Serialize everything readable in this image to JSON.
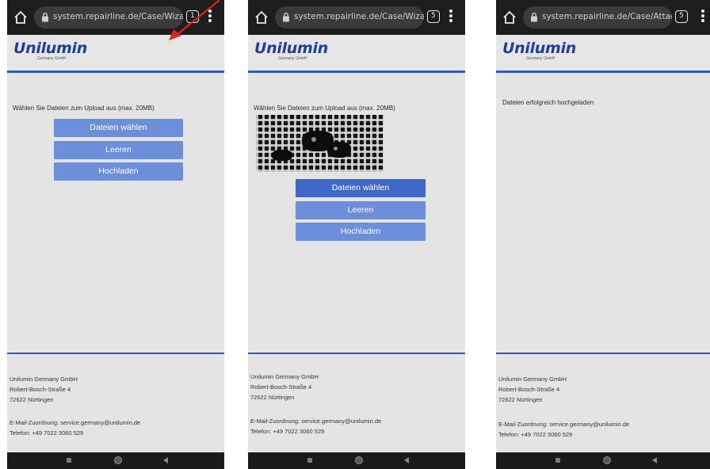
{
  "phones": [
    {
      "url": "system.repairline.de/Case/Wizard/A",
      "tab_count": "1",
      "logo": "Unilumin",
      "logo_sub": "Germany GmbH",
      "message": "Wählen Sie Dateien zum Upload aus (max. 20MB)",
      "buttons": [
        "Dateien wählen",
        "Leeren",
        "Hochladen"
      ]
    },
    {
      "url": "system.repairline.de/Case/Wizard/A",
      "tab_count": "5",
      "logo": "Unilumin",
      "logo_sub": "Germany GmbH",
      "message": "Wählen Sie Dateien zum Upload aus (max. 20MB)",
      "buttons": [
        "Dateien wählen",
        "Leeren",
        "Hochladen"
      ]
    },
    {
      "url": "system.repairline.de/Case/Attachme",
      "tab_count": "5",
      "logo": "Unilumin",
      "logo_sub": "Germany GmbH",
      "message": "Dateien erfolgreich hochgeladen"
    }
  ],
  "footer": {
    "company": "Unilumin Germany GmbH",
    "street": "Robert-Bosch-Straße 4",
    "city": "72622 Nürtingen",
    "email_line": "E-Mail-Zuordnung: service.germany@unilumin.de",
    "phone_line": "Telefon: +49 7022 3060 529"
  },
  "colors": {
    "button": "#6d8fdb",
    "button_active": "#3e67c8",
    "accent_line": "#2f58b8",
    "logo": "#1f3f9a",
    "annotation_arrow": "#e0231c"
  }
}
